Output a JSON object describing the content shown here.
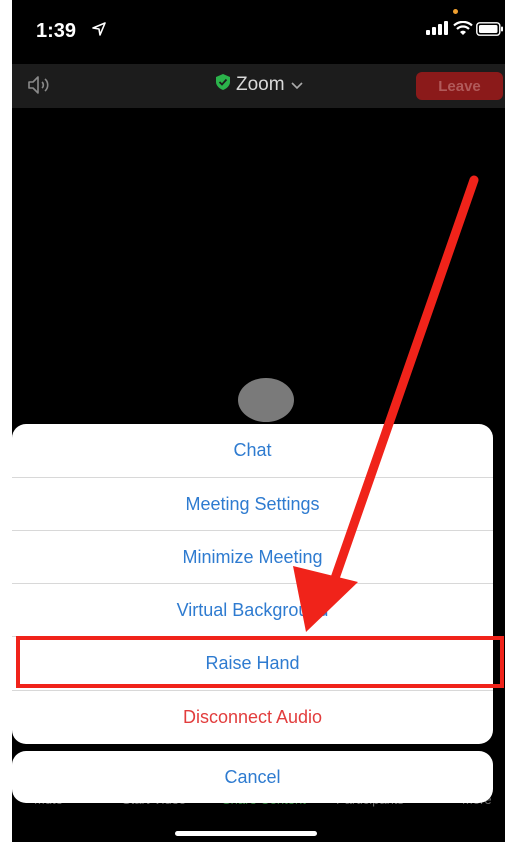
{
  "status_bar": {
    "time": "1:39",
    "icons": [
      "location-arrow-icon",
      "signal-bars-icon",
      "wifi-icon",
      "battery-icon"
    ]
  },
  "meeting_bar": {
    "speaker_icon": "speaker-icon",
    "title": "Zoom",
    "title_icons": [
      "shield-check-icon",
      "chevron-down-icon"
    ],
    "leave_label": "Leave"
  },
  "action_sheet": {
    "items": [
      {
        "label": "Chat"
      },
      {
        "label": "Meeting Settings"
      },
      {
        "label": "Minimize Meeting"
      },
      {
        "label": "Virtual Background"
      },
      {
        "label": "Raise Hand"
      },
      {
        "label": "Disconnect Audio"
      }
    ],
    "cancel_label": "Cancel"
  },
  "bottom_toolbar": {
    "labels": [
      "Mute",
      "Start Video",
      "Share Content",
      "Participants",
      "More"
    ]
  },
  "annotation": {
    "highlighted_item": "Raise Hand",
    "color": "#f0231a"
  },
  "colors": {
    "accent": "#2e7bd0",
    "danger": "#e23d3d",
    "leave": "#8b1a1a",
    "shield": "#2bb34b"
  }
}
